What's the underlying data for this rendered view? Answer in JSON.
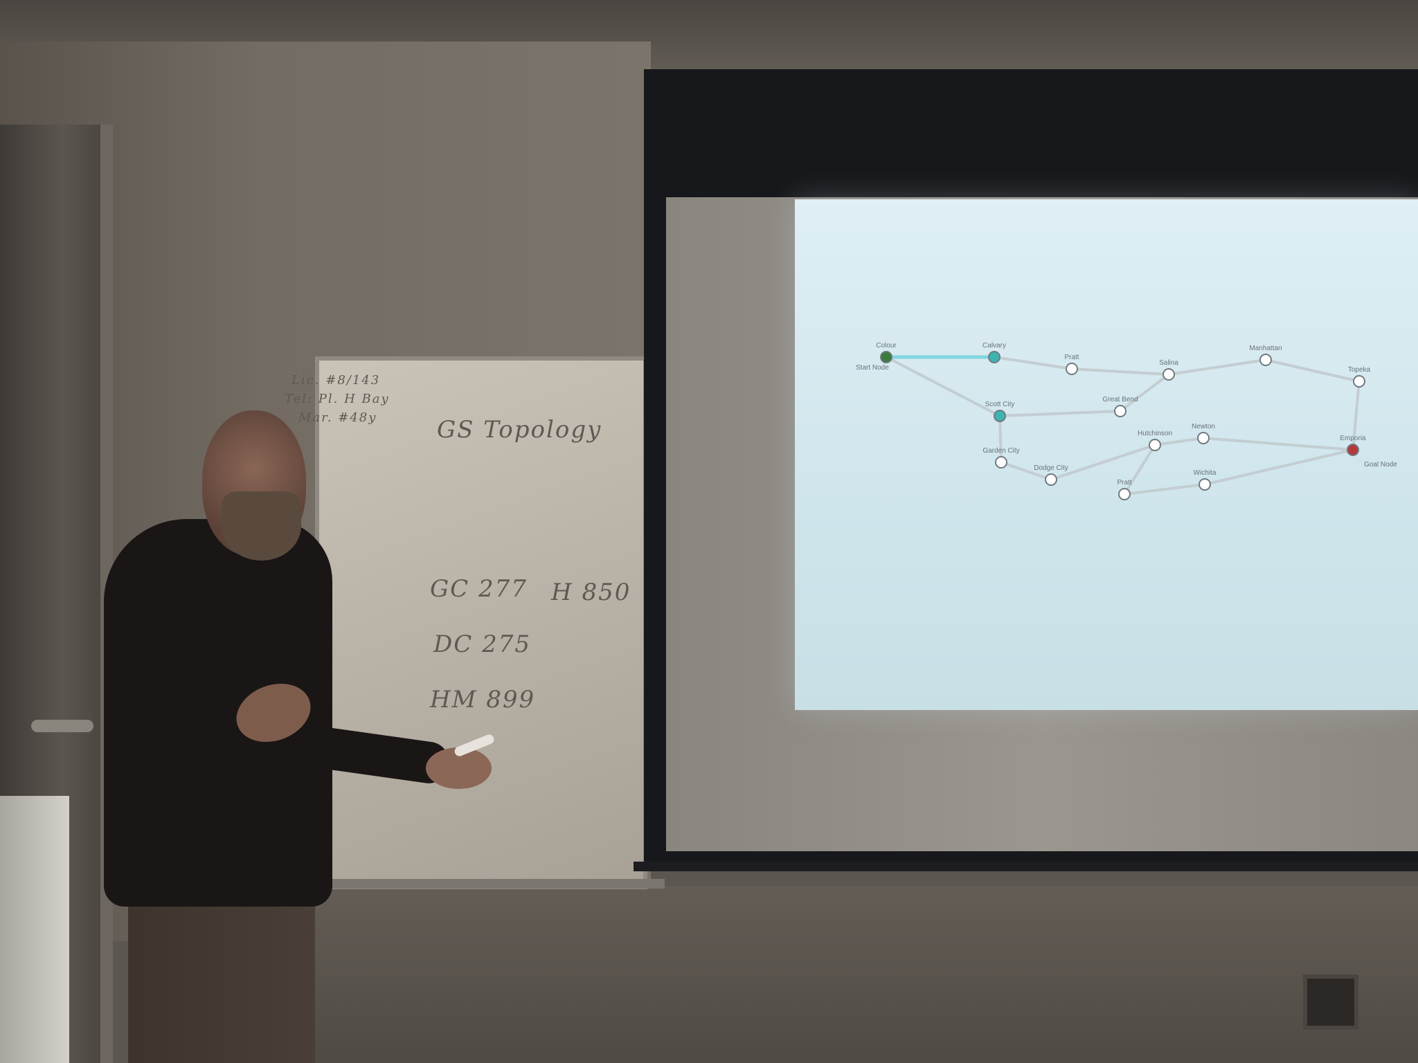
{
  "scene": {
    "description_label": "",
    "whiteboard": {
      "lines": [
        "Lic. #8/143",
        "Tel: Pl. H Bay",
        "Mar. #48y",
        "GS Topology",
        "DC 275",
        "H 850",
        "GC 277",
        "HM 899"
      ]
    },
    "graph": {
      "nodes": [
        {
          "id": "n1",
          "label": "Colour",
          "colour": "#3d7a3d"
        },
        {
          "id": "n2",
          "label": "Calvary",
          "colour": "#3fb3b0"
        },
        {
          "id": "n3",
          "label": "Pratt",
          "colour": "#ffffff"
        },
        {
          "id": "n4",
          "label": "Salina",
          "colour": "#ffffff"
        },
        {
          "id": "n5",
          "label": "Manhattan",
          "colour": "#ffffff"
        },
        {
          "id": "n6",
          "label": "Topeka",
          "colour": "#ffffff"
        },
        {
          "id": "n7",
          "label": "Scott City",
          "colour": "#3fb3b0"
        },
        {
          "id": "n8",
          "label": "Great Bend",
          "colour": "#ffffff"
        },
        {
          "id": "n9",
          "label": "Garden City",
          "colour": "#ffffff"
        },
        {
          "id": "n10",
          "label": "Dodge City",
          "colour": "#ffffff"
        },
        {
          "id": "n11",
          "label": "Hutchinson",
          "colour": "#ffffff"
        },
        {
          "id": "n12",
          "label": "Newton",
          "colour": "#ffffff"
        },
        {
          "id": "n13",
          "label": "Emporia",
          "colour": "#b33a3a"
        },
        {
          "id": "n14",
          "label": "Pratt",
          "colour": "#ffffff"
        },
        {
          "id": "n15",
          "label": "Wichita",
          "colour": "#ffffff"
        }
      ],
      "start_label": "Start Node",
      "goal_label": "Goal Node"
    }
  }
}
